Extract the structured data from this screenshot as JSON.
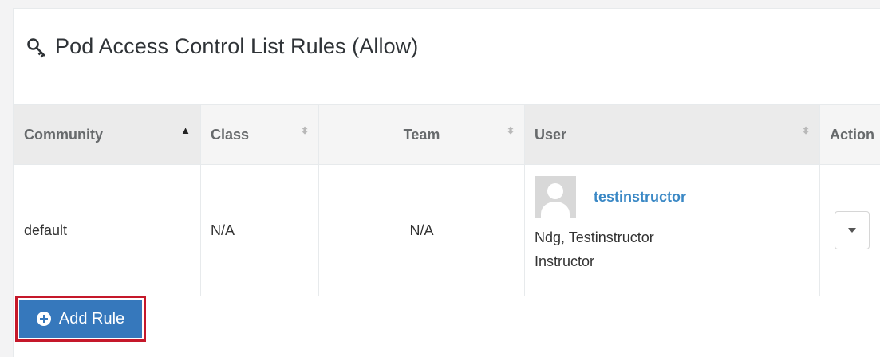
{
  "panel": {
    "title": "Pod Access Control List Rules (Allow)",
    "title_icon": "key-icon"
  },
  "table": {
    "columns": [
      {
        "label": "Community",
        "sort": "ascending"
      },
      {
        "label": "Class",
        "sort": "none"
      },
      {
        "label": "Team",
        "sort": "none"
      },
      {
        "label": "User",
        "sort": "none"
      },
      {
        "label": "Action",
        "sort": "none"
      }
    ],
    "rows": [
      {
        "community": "default",
        "class": "N/A",
        "team": "N/A",
        "user": {
          "username": "testinstructor",
          "full_name": "Ndg, Testinstructor",
          "role": "Instructor",
          "avatar": "default-avatar-icon"
        },
        "action_icon": "caret-down-icon"
      }
    ]
  },
  "add_button": {
    "label": "Add Rule",
    "icon": "plus-circle-icon"
  },
  "colors": {
    "primary": "#3678bc",
    "highlight_border": "#c5182a",
    "link": "#3a88c5"
  }
}
